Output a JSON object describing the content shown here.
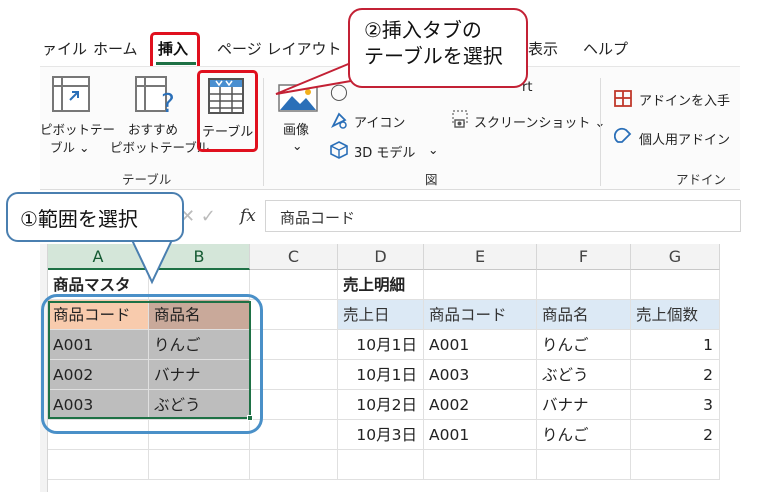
{
  "ribbon_tabs": [
    {
      "label": "ァイル"
    },
    {
      "label": "ホーム"
    },
    {
      "label": "挿入"
    },
    {
      "label": "ページ レイアウト"
    },
    {
      "label": "表示"
    },
    {
      "label": "ヘルプ"
    }
  ],
  "ribbon": {
    "pivot_table_line1": "ピボットテー",
    "pivot_table_line2": "ブル ⌄",
    "recommended_pivot_line1": "おすすめ",
    "recommended_pivot_line2": "ピボットテーブル",
    "table_button": "テーブル",
    "pictures_button": "画像",
    "pictures_chevron": "⌄",
    "icons_button": "アイコン",
    "models_3d_button": "3D モデル",
    "models_3d_chevron": "⌄",
    "smartart_fragment": "rt",
    "screenshot_button": "スクリーンショット ⌄",
    "get_addins_button": "アドインを入手",
    "my_addins_button": "個人用アドイン",
    "group_tables": "テーブル",
    "group_illustrations": "図",
    "group_addins": "アドイン"
  },
  "formula_bar": {
    "fx_label": "fx",
    "value": "商品コード"
  },
  "columns": [
    "A",
    "B",
    "C",
    "D",
    "E",
    "F",
    "G"
  ],
  "sheet": {
    "master_title": "商品マスタ",
    "sales_title": "売上明細",
    "master_headers": [
      "商品コード",
      "商品名"
    ],
    "master_rows": [
      [
        "A001",
        "りんご"
      ],
      [
        "A002",
        "バナナ"
      ],
      [
        "A003",
        "ぶどう"
      ]
    ],
    "sales_headers": [
      "売上日",
      "商品コード",
      "商品名",
      "売上個数"
    ],
    "sales_rows": [
      [
        "10月1日",
        "A001",
        "りんご",
        "1"
      ],
      [
        "10月1日",
        "A003",
        "ぶどう",
        "2"
      ],
      [
        "10月2日",
        "A002",
        "バナナ",
        "3"
      ],
      [
        "10月3日",
        "A001",
        "りんご",
        "2"
      ]
    ]
  },
  "callouts": {
    "insert_tab_line1": "②挿入タブの",
    "insert_tab_line2": "テーブルを選択",
    "select_range": "①範囲を選択"
  },
  "colors": {
    "excel_green": "#1e7145",
    "annotation_red": "#e0101e",
    "annotation_blue": "#4a90c8"
  }
}
